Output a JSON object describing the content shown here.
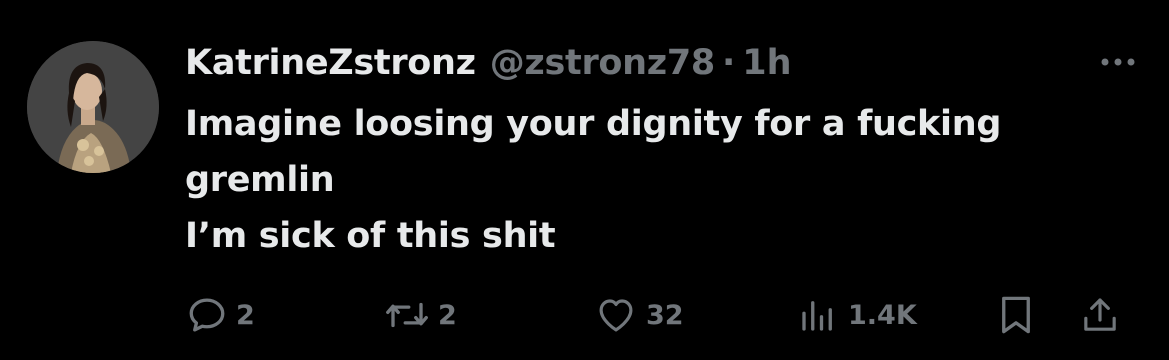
{
  "user": {
    "display_name": "KatrineZstronz",
    "handle": "@zstronz78",
    "separator": "·",
    "time": "1h"
  },
  "tweet": {
    "lines": [
      "Imagine loosing your dignity for a fucking",
      "gremlin",
      "I’m sick of this shit"
    ]
  },
  "actions": {
    "replies": "2",
    "reposts": "2",
    "likes": "32",
    "views": "1.4K"
  },
  "icons": {
    "more": "more-horizontal-icon",
    "reply": "reply-bubble-icon",
    "repost": "repost-arrows-icon",
    "like": "heart-icon",
    "views": "views-bar-chart-icon",
    "bookmark": "bookmark-icon",
    "share": "share-upload-icon"
  },
  "colors": {
    "background": "#000000",
    "primary_text": "#e7e9ea",
    "secondary_text": "#71767b"
  }
}
